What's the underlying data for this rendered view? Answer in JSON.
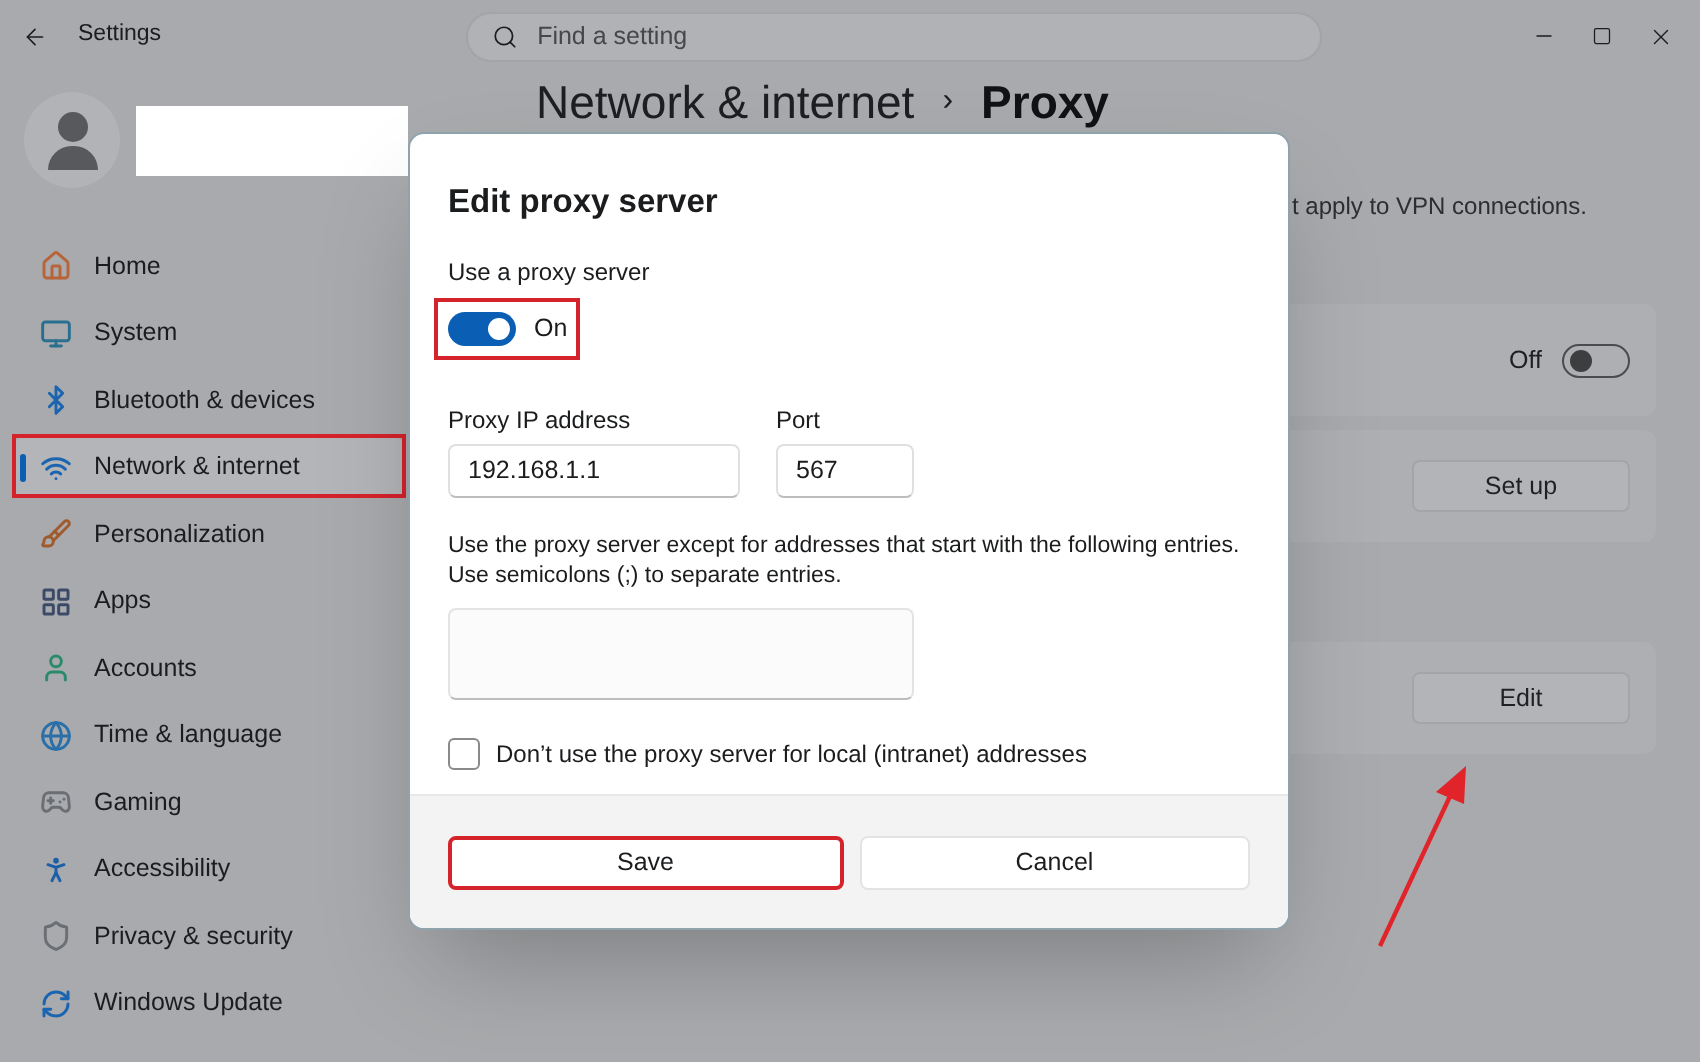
{
  "window": {
    "title": "Settings",
    "search": {
      "placeholder": "Find a setting"
    }
  },
  "sidebar": {
    "items": [
      {
        "label": "Home",
        "kind": "home",
        "selected": false
      },
      {
        "label": "System",
        "kind": "system",
        "selected": false
      },
      {
        "label": "Bluetooth & devices",
        "kind": "bluetooth",
        "selected": false
      },
      {
        "label": "Network & internet",
        "kind": "network",
        "selected": true
      },
      {
        "label": "Personalization",
        "kind": "brush",
        "selected": false
      },
      {
        "label": "Apps",
        "kind": "apps",
        "selected": false
      },
      {
        "label": "Accounts",
        "kind": "account",
        "selected": false
      },
      {
        "label": "Time & language",
        "kind": "time",
        "selected": false
      },
      {
        "label": "Gaming",
        "kind": "gaming",
        "selected": false
      },
      {
        "label": "Accessibility",
        "kind": "accessibility",
        "selected": false
      },
      {
        "label": "Privacy & security",
        "kind": "privacy",
        "selected": false
      },
      {
        "label": "Windows Update",
        "kind": "update",
        "selected": false
      }
    ]
  },
  "page": {
    "breadcrumb": [
      "Network & internet",
      "Proxy"
    ],
    "separator": "›",
    "note": "t apply to VPN connections.",
    "cards": [
      {
        "kind": "toggle",
        "state_label": "Off",
        "on": false
      },
      {
        "kind": "button",
        "button": "Set up"
      },
      {
        "kind": "button",
        "button": "Edit"
      }
    ]
  },
  "dialog": {
    "title": "Edit proxy server",
    "use_proxy": {
      "label": "Use a proxy server",
      "on": true,
      "state_label": "On"
    },
    "fields": [
      {
        "label": "Proxy IP address",
        "value": "192.168.1.1"
      },
      {
        "label": "Port",
        "value": "567"
      }
    ],
    "exceptions": {
      "description_lines": [
        "Use the proxy server except for addresses that start with the following entries.",
        "Use semicolons (;) to separate entries."
      ]
    },
    "local_bypass": {
      "label": "Don’t use the proxy server for local (intranet) addresses",
      "checked": false
    },
    "buttons": [
      "Save",
      "Cancel"
    ]
  }
}
